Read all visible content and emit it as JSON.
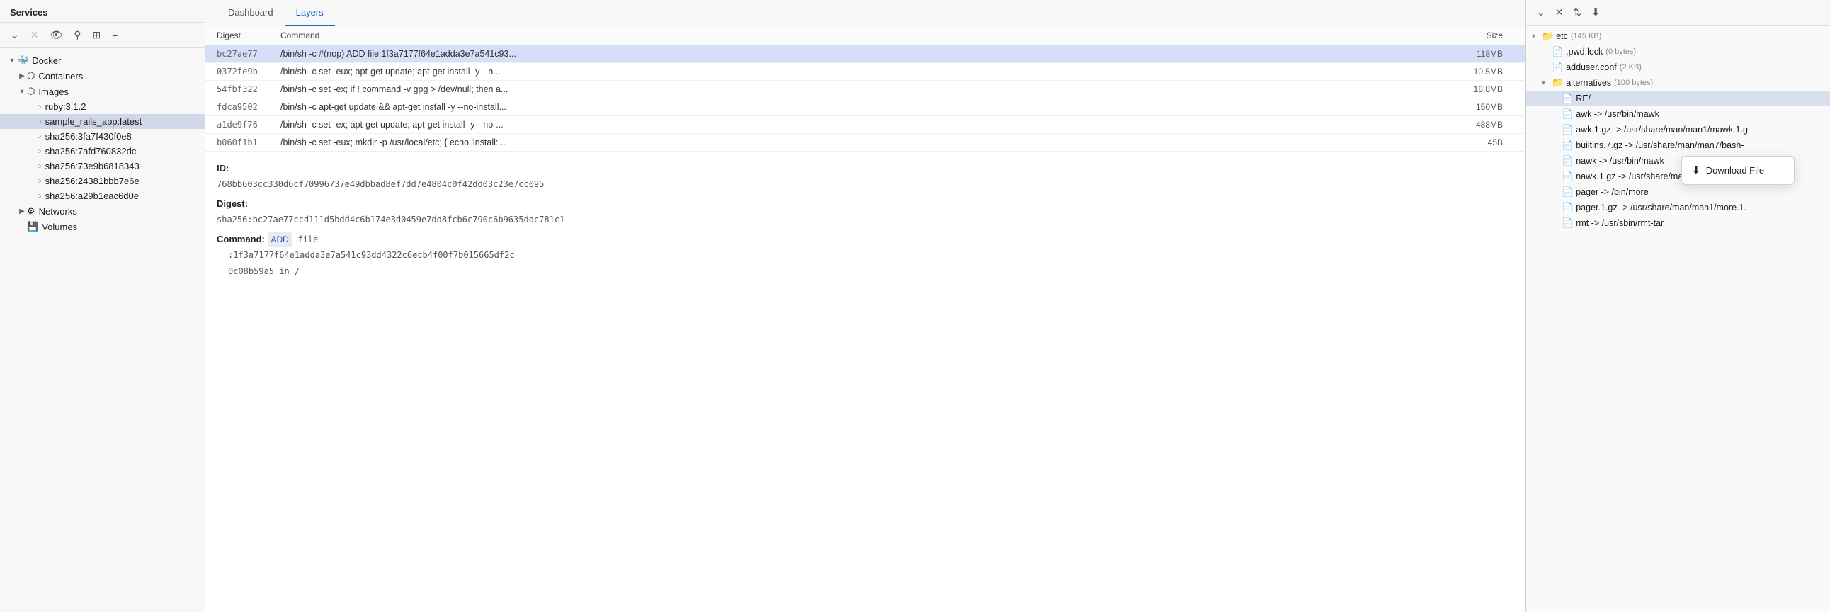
{
  "sidebar": {
    "header": "Services",
    "tree": [
      {
        "id": "docker",
        "label": "Docker",
        "indent": 0,
        "arrow": "▾",
        "icon": "🐳",
        "type": "root"
      },
      {
        "id": "containers",
        "label": "Containers",
        "indent": 1,
        "arrow": "▶",
        "icon": "🗂",
        "type": "group"
      },
      {
        "id": "images",
        "label": "Images",
        "indent": 1,
        "arrow": "▾",
        "icon": "🗂",
        "type": "group"
      },
      {
        "id": "ruby",
        "label": "ruby:3.1.2",
        "indent": 2,
        "arrow": "",
        "icon": "○",
        "type": "item"
      },
      {
        "id": "sample",
        "label": "sample_rails_app:latest",
        "indent": 2,
        "arrow": "",
        "icon": "○",
        "type": "item",
        "selected": true
      },
      {
        "id": "sha1",
        "label": "sha256:3fa7f430f0e8",
        "indent": 2,
        "arrow": "",
        "icon": "○",
        "type": "item"
      },
      {
        "id": "sha2",
        "label": "sha256:7afd760832dc",
        "indent": 2,
        "arrow": "",
        "icon": "○",
        "type": "item"
      },
      {
        "id": "sha3",
        "label": "sha256:73e9b6818343",
        "indent": 2,
        "arrow": "",
        "icon": "○",
        "type": "item"
      },
      {
        "id": "sha4",
        "label": "sha256:24381bbb7e6e",
        "indent": 2,
        "arrow": "",
        "icon": "○",
        "type": "item"
      },
      {
        "id": "sha5",
        "label": "sha256:a29b1eac6d0e",
        "indent": 2,
        "arrow": "",
        "icon": "○",
        "type": "item"
      },
      {
        "id": "networks",
        "label": "Networks",
        "indent": 1,
        "arrow": "▶",
        "icon": "🌐",
        "type": "group"
      },
      {
        "id": "volumes",
        "label": "Volumes",
        "indent": 1,
        "arrow": "",
        "icon": "💾",
        "type": "item"
      }
    ]
  },
  "tabs": {
    "items": [
      {
        "id": "dashboard",
        "label": "Dashboard"
      },
      {
        "id": "layers",
        "label": "Layers"
      }
    ],
    "active": "layers"
  },
  "layers_table": {
    "columns": {
      "digest": "Digest",
      "command": "Command",
      "size": "Size"
    },
    "rows": [
      {
        "digest": "bc27ae77",
        "command": "/bin/sh -c #(nop) ADD file:1f3a7177f64e1adda3e7a541c93...",
        "size": "118MB",
        "selected": true
      },
      {
        "digest": "0372fe9b",
        "command": "/bin/sh -c set -eux; apt-get update; apt-get install -y --n...",
        "size": "10.5MB"
      },
      {
        "digest": "54fbf322",
        "command": "/bin/sh -c set -ex; if ! command -v gpg > /dev/null; then a...",
        "size": "18.8MB"
      },
      {
        "digest": "fdca9502",
        "command": "/bin/sh -c apt-get update && apt-get install -y --no-install...",
        "size": "150MB"
      },
      {
        "digest": "a1de9f76",
        "command": "/bin/sh -c set -ex; apt-get update; apt-get install -y --no-...",
        "size": "488MB"
      },
      {
        "digest": "b060f1b1",
        "command": "/bin/sh -c set -eux; mkdir -p /usr/local/etc; { echo 'install:...",
        "size": "45B"
      }
    ]
  },
  "detail": {
    "id_label": "ID:",
    "id_value": "768bb603cc330d6cf70996737e49dbbad8ef7dd7e4804c0f42dd03c23e7cc095",
    "digest_label": "Digest:",
    "digest_value": "sha256:bc27ae77ccd111d5bdd4c6b174e3d0459e7dd8fcb6c790c6b9635ddc781c1",
    "command_label": "Command:",
    "command_tag": "ADD",
    "command_content": "file",
    "command_line2": ":1f3a7177f64e1adda3e7a541c93dd4322c6ecb4f00f7b015665df2c",
    "command_line3": "0c08b59a5 in /"
  },
  "file_panel": {
    "items": [
      {
        "id": "etc-folder",
        "label": "etc",
        "size": "(145 KB)",
        "indent": "fi-1",
        "arrow": "▾",
        "icon": "📁",
        "type": "folder"
      },
      {
        "id": "pwd-lock",
        "label": ".pwd.lock",
        "size": "(0 bytes)",
        "indent": "fi-2",
        "arrow": "",
        "icon": "📄",
        "type": "file"
      },
      {
        "id": "adduser-conf",
        "label": "adduser.conf",
        "size": "(2 KB)",
        "indent": "fi-2",
        "arrow": "",
        "icon": "📄",
        "type": "file"
      },
      {
        "id": "alternatives",
        "label": "alternatives",
        "size": "(100 bytes)",
        "indent": "fi-2",
        "arrow": "▾",
        "icon": "📁",
        "type": "folder"
      },
      {
        "id": "readme-file",
        "label": "RE/",
        "size": "",
        "indent": "fi-3",
        "arrow": "",
        "icon": "📄",
        "type": "file",
        "selected": true
      },
      {
        "id": "awk-link",
        "label": "awk -> /usr/bin/mawk",
        "size": "",
        "indent": "fi-3",
        "arrow": "",
        "icon": "📄",
        "type": "file"
      },
      {
        "id": "awk1gz-link",
        "label": "awk.1.gz -> /usr/share/man/man1/mawk.1.g",
        "size": "",
        "indent": "fi-3",
        "arrow": "",
        "icon": "📄",
        "type": "file"
      },
      {
        "id": "builtins-link",
        "label": "builtins.7.gz -> /usr/share/man/man7/bash-",
        "size": "",
        "indent": "fi-3",
        "arrow": "",
        "icon": "📄",
        "type": "file"
      },
      {
        "id": "nawk-link",
        "label": "nawk -> /usr/bin/mawk",
        "size": "",
        "indent": "fi-3",
        "arrow": "",
        "icon": "📄",
        "type": "file"
      },
      {
        "id": "nawk1gz-link",
        "label": "nawk.1.gz -> /usr/share/man/man1/mawk.1",
        "size": "",
        "indent": "fi-3",
        "arrow": "",
        "icon": "📄",
        "type": "file"
      },
      {
        "id": "pager-link",
        "label": "pager -> /bin/more",
        "size": "",
        "indent": "fi-3",
        "arrow": "",
        "icon": "📄",
        "type": "file"
      },
      {
        "id": "pager1gz-link",
        "label": "pager.1.gz -> /usr/share/man/man1/more.1.",
        "size": "",
        "indent": "fi-3",
        "arrow": "",
        "icon": "📄",
        "type": "file"
      },
      {
        "id": "rmt-link",
        "label": "rmt -> /usr/sbin/rmt-tar",
        "size": "",
        "indent": "fi-3",
        "arrow": "",
        "icon": "📄",
        "type": "file"
      }
    ]
  },
  "dropdown": {
    "visible": true,
    "items": [
      {
        "id": "download-file",
        "label": "Download File",
        "icon": "download"
      }
    ]
  },
  "icons": {
    "collapse": "⌄",
    "close": "✕",
    "sort": "⇅",
    "download": "⬇",
    "eye": "👁",
    "filter": "⚲",
    "new_tab": "⊕",
    "plus": "+"
  }
}
